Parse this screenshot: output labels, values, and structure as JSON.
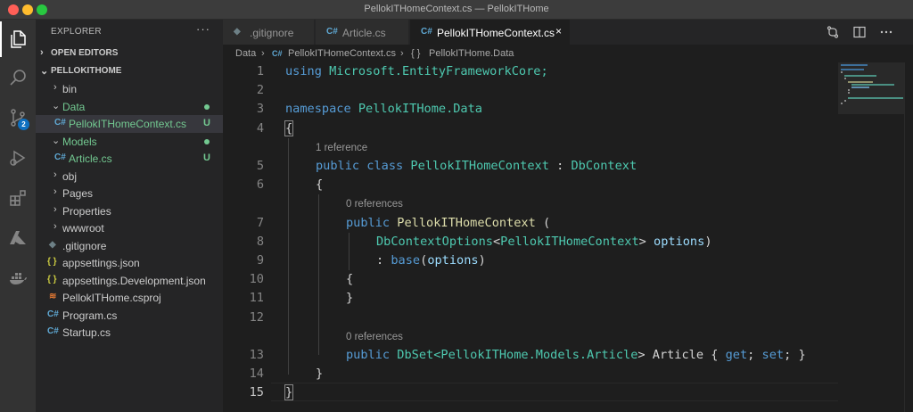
{
  "window": {
    "title": "PellokITHomeContext.cs — PellokITHome"
  },
  "activity_bar": {
    "items": [
      {
        "name": "explorer-icon",
        "active": true
      },
      {
        "name": "search-icon"
      },
      {
        "name": "source-control-icon",
        "badge": "2"
      },
      {
        "name": "run-debug-icon"
      },
      {
        "name": "extensions-icon"
      },
      {
        "name": "azure-icon"
      },
      {
        "name": "docker-icon"
      }
    ]
  },
  "sidebar": {
    "title": "EXPLORER",
    "more": "···",
    "open_editors": "OPEN EDITORS",
    "project": "PELLOKITHOME",
    "items": [
      {
        "label": "bin",
        "type": "folder",
        "depth": 1,
        "expanded": false
      },
      {
        "label": "Data",
        "type": "folder",
        "depth": 1,
        "expanded": true,
        "git": "dot"
      },
      {
        "label": "PellokITHomeContext.cs",
        "type": "cs",
        "depth": 2,
        "git": "U",
        "selected": true
      },
      {
        "label": "Models",
        "type": "folder",
        "depth": 1,
        "expanded": true,
        "git": "dot"
      },
      {
        "label": "Article.cs",
        "type": "cs",
        "depth": 2,
        "git": "U"
      },
      {
        "label": "obj",
        "type": "folder",
        "depth": 1,
        "expanded": false
      },
      {
        "label": "Pages",
        "type": "folder",
        "depth": 1,
        "expanded": false
      },
      {
        "label": "Properties",
        "type": "folder",
        "depth": 1,
        "expanded": false
      },
      {
        "label": "wwwroot",
        "type": "folder",
        "depth": 1,
        "expanded": false
      },
      {
        "label": ".gitignore",
        "type": "git",
        "depth": 1
      },
      {
        "label": "appsettings.json",
        "type": "json",
        "depth": 1
      },
      {
        "label": "appsettings.Development.json",
        "type": "json",
        "depth": 1
      },
      {
        "label": "PellokITHome.csproj",
        "type": "rss",
        "depth": 1
      },
      {
        "label": "Program.cs",
        "type": "cs",
        "depth": 1
      },
      {
        "label": "Startup.cs",
        "type": "cs",
        "depth": 1
      }
    ]
  },
  "tabs": [
    {
      "label": ".gitignore",
      "icon": "git"
    },
    {
      "label": "Article.cs",
      "icon": "cs"
    },
    {
      "label": "PellokITHomeContext.cs",
      "icon": "cs",
      "active": true,
      "close": "×"
    }
  ],
  "breadcrumb": {
    "folder": "Data",
    "sep1": "›",
    "file": "PellokITHomeContext.cs",
    "sep2": "›",
    "symbol_icon": "{ }",
    "symbol": "PellokITHome.Data"
  },
  "icons": {
    "cs": "C#",
    "json": "{ }",
    "git": "◆",
    "rss": "≋",
    "chevron_down": "⌄",
    "chevron_right": "›"
  },
  "colors": {
    "keyword": "#569cd6",
    "type": "#4ec9b0",
    "function": "#dcdcaa",
    "parameter": "#9cdcfe",
    "git_untracked": "#73c991"
  },
  "code": {
    "lens_1": "1 reference",
    "lens_0a": "0 references",
    "lens_0b": "0 references",
    "l1_a": "using",
    "l1_b": " Microsoft.EntityFrameworkCore;",
    "l3_a": "namespace",
    "l3_b": " PellokITHome.Data",
    "l4": "{",
    "l5_a": "public",
    "l5_b": " class ",
    "l5_c": "PellokITHomeContext",
    "l5_d": " : ",
    "l5_e": "DbContext",
    "l6": "{",
    "l7_a": "public",
    "l7_b": " ",
    "l7_c": "PellokITHomeContext",
    "l7_d": " (",
    "l8_a": "DbContextOptions",
    "l8_b": "<",
    "l8_c": "PellokITHomeContext",
    "l8_d": "> ",
    "l8_e": "options",
    "l8_f": ")",
    "l9_a": ": ",
    "l9_b": "base",
    "l9_c": "(",
    "l9_d": "options",
    "l9_e": ")",
    "l10": "{",
    "l11": "}",
    "l13_a": "public",
    "l13_b": " ",
    "l13_c": "DbSet",
    "l13_d": "<PellokITHome.Models.",
    "l13_e": "Article",
    "l13_f": "> Article { ",
    "l13_g": "get",
    "l13_h": "; ",
    "l13_i": "set",
    "l13_j": "; }",
    "l14": "}",
    "l15": "}"
  }
}
